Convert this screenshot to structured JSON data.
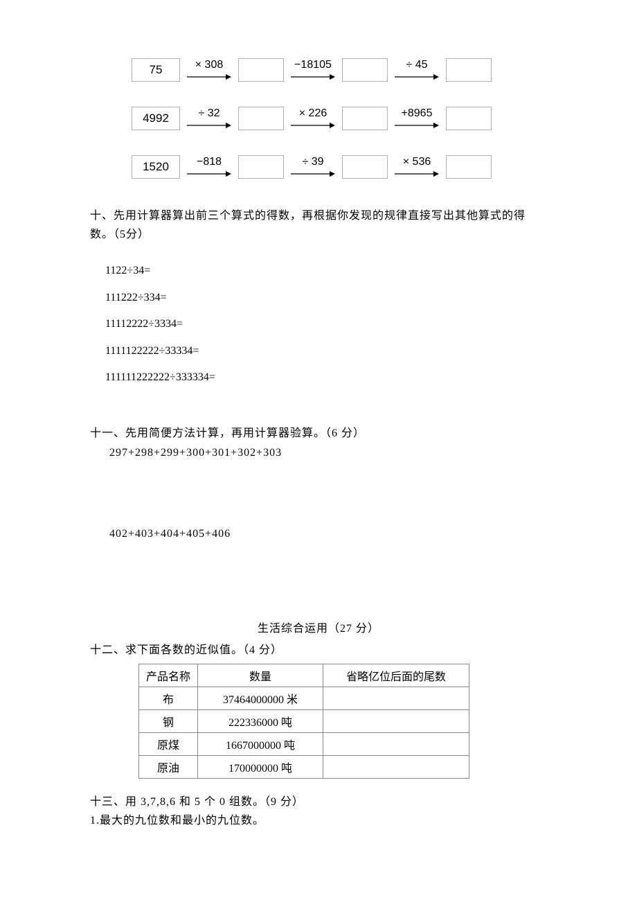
{
  "flows": [
    {
      "start": "75",
      "ops": [
        "× 308",
        "−18105",
        "÷ 45"
      ]
    },
    {
      "start": "4992",
      "ops": [
        "÷ 32",
        "× 226",
        "+8965"
      ]
    },
    {
      "start": "1520",
      "ops": [
        "−818",
        "÷ 39",
        "× 536"
      ]
    }
  ],
  "q10": {
    "title": "十、先用计算器算出前三个算式的得数，再根据你发现的规律直接写出其他算式的得数。（5分）",
    "eqs": [
      "1122÷34=",
      "111222÷334=",
      "11112222÷3334=",
      "1111122222÷33334=",
      "111111222222÷333334="
    ]
  },
  "q11": {
    "title": "十一、先用简便方法计算，再用计算器验算。（6 分）",
    "expr1": "297+298+299+300+301+302+303",
    "expr2": "402+403+404+405+406"
  },
  "life_title": "生活综合运用（27 分）",
  "q12": {
    "title": "十二、求下面各数的近似值。（4 分）",
    "headers": {
      "name": "产品名称",
      "qty": "数量",
      "approx": "省略亿位后面的尾数"
    },
    "rows": [
      {
        "name": "布",
        "qty": "37464000000 米"
      },
      {
        "name": "钢",
        "qty": "222336000 吨"
      },
      {
        "name": "原煤",
        "qty": "1667000000 吨"
      },
      {
        "name": "原油",
        "qty": "170000000 吨"
      }
    ]
  },
  "q13": {
    "title": "十三、用 3,7,8,6 和 5 个 0 组数。（9 分）",
    "sub1": "1.最大的九位数和最小的九位数。"
  }
}
